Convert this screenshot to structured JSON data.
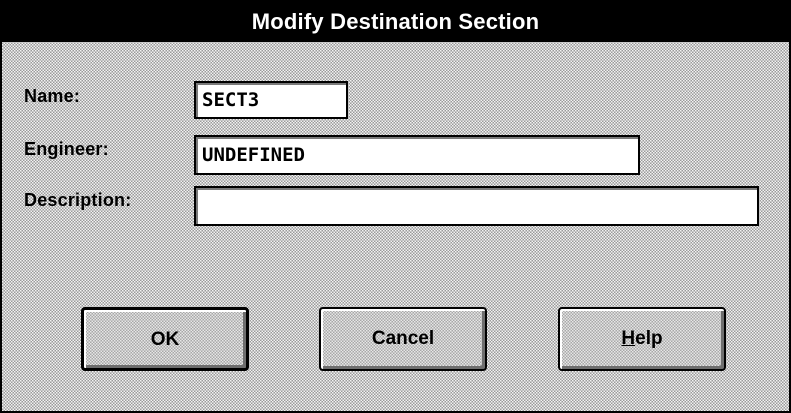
{
  "dialog": {
    "title": "Modify Destination Section"
  },
  "form": {
    "name_label": "Name:",
    "name_value": "SECT3",
    "engineer_label": "Engineer:",
    "engineer_value": "UNDEFINED",
    "description_label": "Description:",
    "description_value": ""
  },
  "buttons": {
    "ok_label": "OK",
    "cancel_label": "Cancel",
    "help_mnemonic": "H",
    "help_rest": "elp"
  }
}
